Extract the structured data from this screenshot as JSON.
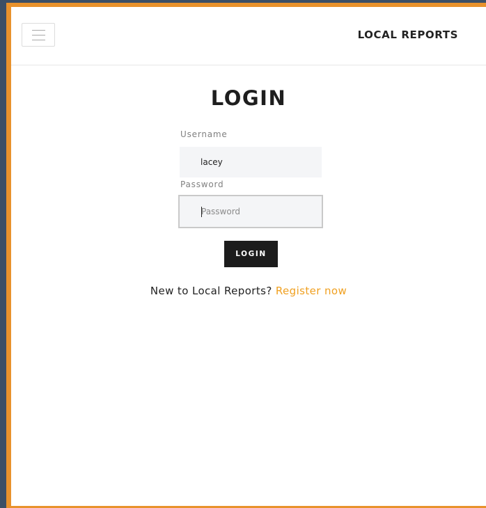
{
  "navbar": {
    "brand": "LOCAL REPORTS",
    "menu_icon": "hamburger-icon"
  },
  "login": {
    "title": "LOGIN",
    "username_label": "Username",
    "username_value": "lacey",
    "password_label": "Password",
    "password_placeholder": "Password",
    "password_value": "",
    "submit_label": "LOGIN"
  },
  "register": {
    "prompt": "New to Local Reports?",
    "link_label": "Register now"
  },
  "colors": {
    "background": "#3b4f66",
    "frame_border": "#e8922c",
    "accent_link": "#f0a020",
    "button_bg": "#1c1c1c",
    "input_bg": "#f4f5f7"
  }
}
